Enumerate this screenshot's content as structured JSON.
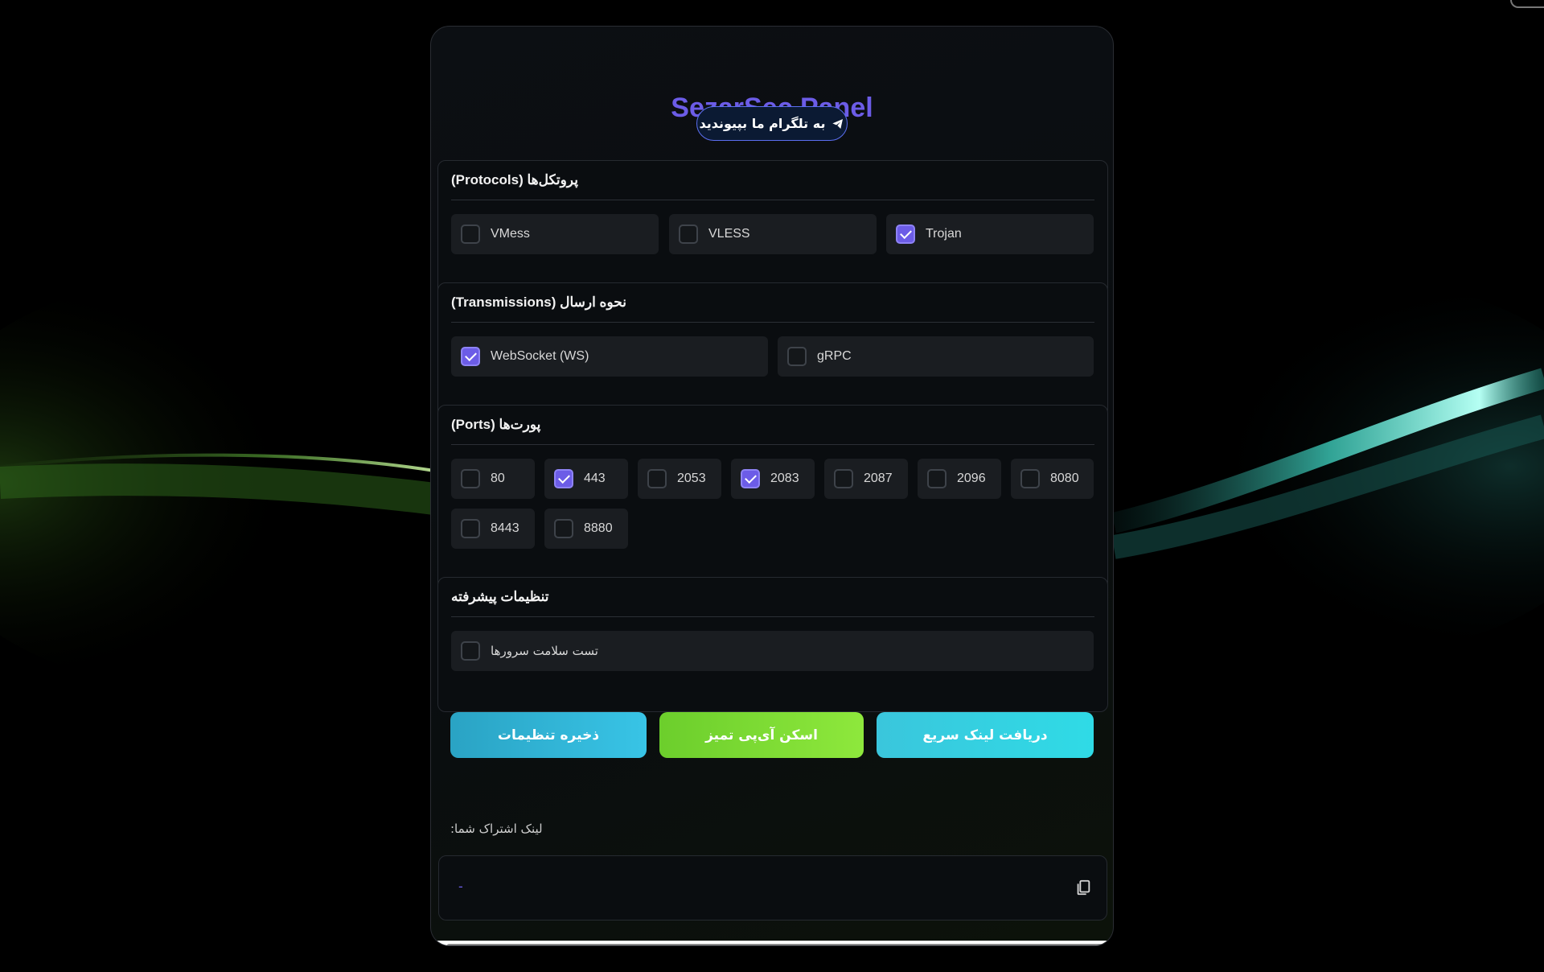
{
  "app": {
    "title": "SezarSec Panel",
    "telegram_button": "به تلگرام ما بپیوندید"
  },
  "sections": {
    "protocols": {
      "title": "پروتکل‌ها (Protocols)",
      "options": [
        {
          "label": "VMess",
          "checked": false
        },
        {
          "label": "VLESS",
          "checked": false
        },
        {
          "label": "Trojan",
          "checked": true
        }
      ]
    },
    "transmissions": {
      "title": "نحوه ارسال (Transmissions)",
      "options": [
        {
          "label": "WebSocket (WS)",
          "checked": true
        },
        {
          "label": "gRPC",
          "checked": false
        }
      ]
    },
    "ports": {
      "title": "پورت‌ها (Ports)",
      "options": [
        {
          "label": "80",
          "checked": false
        },
        {
          "label": "443",
          "checked": true
        },
        {
          "label": "2053",
          "checked": false
        },
        {
          "label": "2083",
          "checked": true
        },
        {
          "label": "2087",
          "checked": false
        },
        {
          "label": "2096",
          "checked": false
        },
        {
          "label": "8080",
          "checked": false
        },
        {
          "label": "8443",
          "checked": false
        },
        {
          "label": "8880",
          "checked": false
        }
      ]
    },
    "advanced": {
      "title": "تنظیمات پیشرفته",
      "options": [
        {
          "label": "تست سلامت سرورها",
          "checked": false
        }
      ]
    }
  },
  "actions": {
    "save": "ذخیره تنظیمات",
    "scan": "اسکن آی‌پی تمیز",
    "quick_link": "دریافت لینک سریع"
  },
  "share": {
    "label": "لینک اشتراک شما:",
    "value": "-"
  },
  "colors": {
    "accent": "#6c5ce7",
    "save_button": "#2fb7d9",
    "scan_button": "#7fdc34",
    "quick_link_button": "#2fd3e6"
  },
  "icons": {
    "telegram": "telegram-icon",
    "copy": "copy-icon"
  }
}
